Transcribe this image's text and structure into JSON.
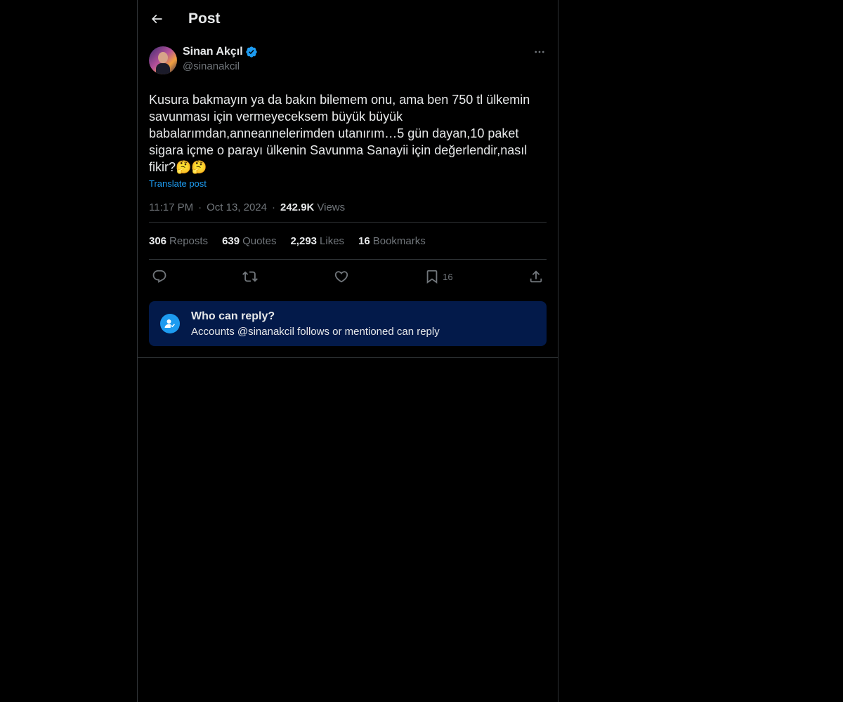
{
  "header": {
    "title": "Post"
  },
  "author": {
    "name": "Sinan Akçıl",
    "handle": "@sinanakcil"
  },
  "post": {
    "text": "Kusura bakmayın ya da bakın bilemem onu, ama ben 750 tl ülkemin\nsavunması için vermeyeceksem büyük büyük\nbabalarımdan,anneannelerimden utanırım…5 gün dayan,10 paket\nsigara içme o parayı ülkenin Savunma Sanayii için değerlendir,nasıl\nfikir?🤔🤔",
    "translate_label": "Translate post",
    "time": "11:17 PM",
    "date": "Oct 13, 2024",
    "views_count": "242.9K",
    "views_label": "Views"
  },
  "stats": {
    "reposts_count": "306",
    "reposts_label": "Reposts",
    "quotes_count": "639",
    "quotes_label": "Quotes",
    "likes_count": "2,293",
    "likes_label": "Likes",
    "bookmarks_count": "16",
    "bookmarks_label": "Bookmarks"
  },
  "actions": {
    "bookmark_count": "16"
  },
  "reply_restriction": {
    "title": "Who can reply?",
    "subtitle": "Accounts @sinanakcil follows or mentioned can reply"
  },
  "colors": {
    "accent": "#1d9bf0",
    "reply_box_bg": "#031a4a",
    "muted": "#71767b"
  }
}
